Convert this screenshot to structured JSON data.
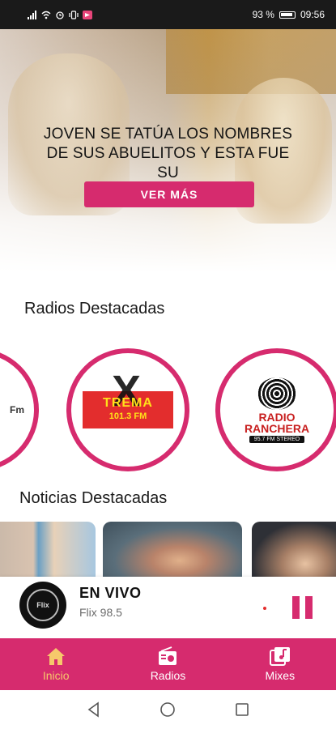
{
  "status_bar": {
    "battery": "93 %",
    "time": "09:56"
  },
  "hero": {
    "headline": "JOVEN SE TATÚA LOS NOMBRES DE SUS ABUELITOS Y ESTA FUE SU",
    "button_label": "VER MÁS"
  },
  "radios": {
    "section_title": "Radios Destacadas",
    "items": [
      {
        "logo_text": "Fm"
      },
      {
        "logo_text": "TREMA",
        "logo_sub": "101.3 FM"
      },
      {
        "logo_text": "RADIO RANCHERA",
        "logo_sub": "95.7 FM STEREO"
      }
    ]
  },
  "news": {
    "section_title": "Noticias Destacadas"
  },
  "player": {
    "title": "EN VIVO",
    "station": "Flix 98.5",
    "logo_text": "Flix"
  },
  "bottom_nav": {
    "items": [
      {
        "label": "Inicio",
        "icon": "home-icon",
        "active": true
      },
      {
        "label": "Radios",
        "icon": "radio-icon",
        "active": false
      },
      {
        "label": "Mixes",
        "icon": "music-library-icon",
        "active": false
      }
    ]
  },
  "colors": {
    "accent": "#d62b6e",
    "active_nav": "#f6c86b",
    "status_bar": "#1a1a1a"
  }
}
